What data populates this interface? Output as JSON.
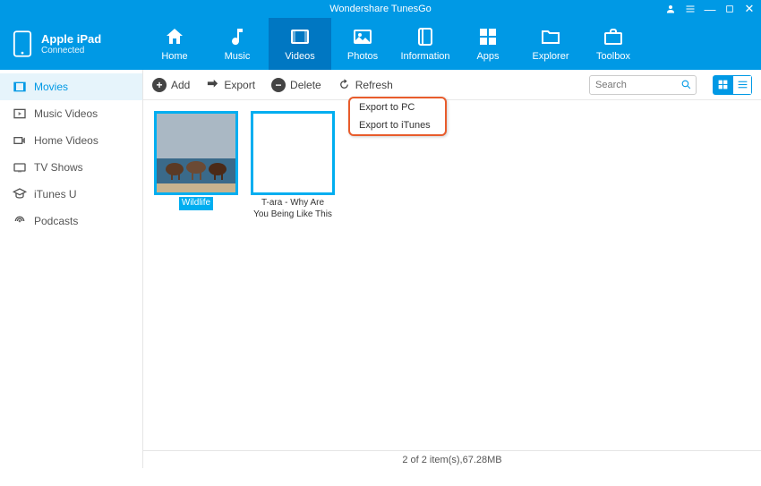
{
  "app": {
    "title": "Wondershare TunesGo"
  },
  "device": {
    "name": "Apple iPad",
    "status": "Connected"
  },
  "nav": {
    "home": "Home",
    "music": "Music",
    "videos": "Videos",
    "photos": "Photos",
    "information": "Information",
    "apps": "Apps",
    "explorer": "Explorer",
    "toolbox": "Toolbox"
  },
  "sidebar": {
    "items": [
      {
        "label": "Movies"
      },
      {
        "label": "Music Videos"
      },
      {
        "label": "Home Videos"
      },
      {
        "label": "TV Shows"
      },
      {
        "label": "iTunes U"
      },
      {
        "label": "Podcasts"
      }
    ]
  },
  "toolbar": {
    "add": "Add",
    "export": "Export",
    "delete": "Delete",
    "refresh": "Refresh",
    "search_placeholder": "Search"
  },
  "export_menu": {
    "to_pc": "Export to PC",
    "to_itunes": "Export to iTunes"
  },
  "gallery": {
    "items": [
      {
        "title": "Wildlife"
      },
      {
        "title": "T-ara - Why Are You Being Like This"
      }
    ]
  },
  "status": {
    "text": "2 of 2 item(s),67.28MB"
  }
}
